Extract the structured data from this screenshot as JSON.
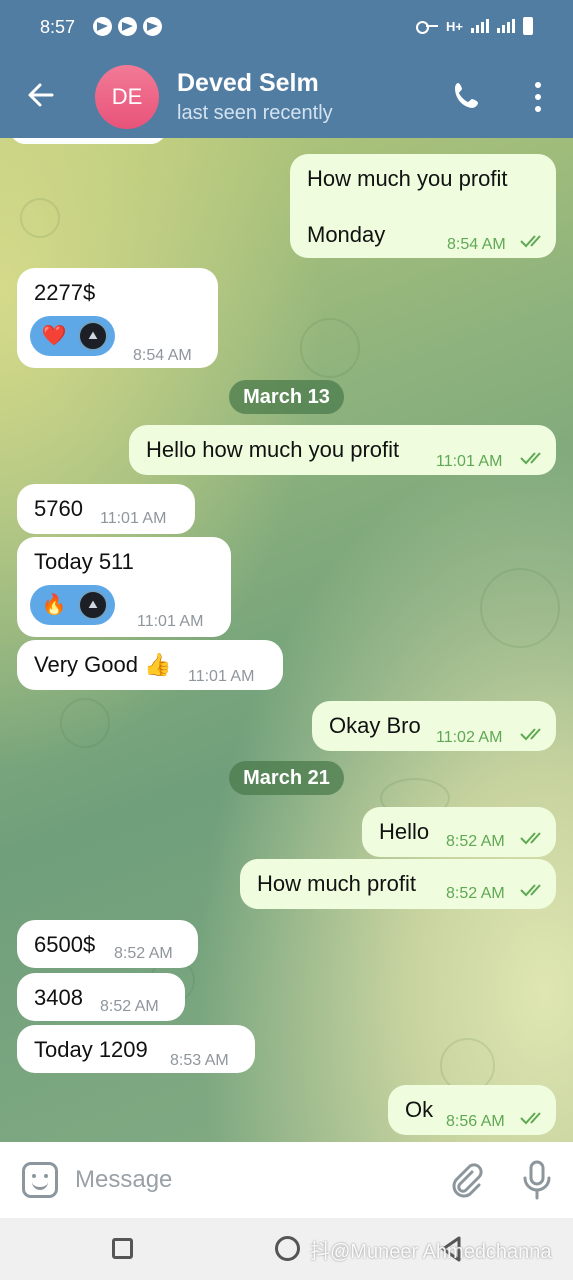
{
  "status_bar": {
    "time": "8:57",
    "network": "H+"
  },
  "header": {
    "avatar_initials": "DE",
    "name": "Deved Selm",
    "status": "last seen recently"
  },
  "dates": [
    "March 13",
    "March 21"
  ],
  "messages": [
    {
      "text": "How much you profit",
      "text2": "Monday",
      "time": "8:54 AM",
      "dir": "out"
    },
    {
      "text": "2277$",
      "time": "8:54 AM",
      "dir": "in",
      "reaction": "heart"
    },
    {
      "text": "Hello how much you profit",
      "time": "11:01 AM",
      "dir": "out"
    },
    {
      "text": "5760",
      "time": "11:01 AM",
      "dir": "in"
    },
    {
      "text": "Today 511",
      "time": "11:01 AM",
      "dir": "in",
      "reaction": "fire"
    },
    {
      "text": "Very Good 👍",
      "time": "11:01 AM",
      "dir": "in"
    },
    {
      "text": "Okay Bro",
      "time": "11:02 AM",
      "dir": "out"
    },
    {
      "text": "Hello",
      "time": "8:52 AM",
      "dir": "out"
    },
    {
      "text": "How much profit",
      "time": "8:52 AM",
      "dir": "out"
    },
    {
      "text": "6500$",
      "time": "8:52 AM",
      "dir": "in"
    },
    {
      "text": "3408",
      "time": "8:52 AM",
      "dir": "in"
    },
    {
      "text": "Today 1209",
      "time": "8:53 AM",
      "dir": "in"
    },
    {
      "text": "Ok",
      "time": "8:56 AM",
      "dir": "out"
    }
  ],
  "reactions": {
    "heart": "❤️",
    "fire": "🔥"
  },
  "input": {
    "placeholder": "Message"
  },
  "watermark": "抖@Muneer Ahmedchanna",
  "colors": {
    "header": "#527da3",
    "outgoing_bubble": "#effdde",
    "incoming_bubble": "#ffffff",
    "read_checks": "#5fa854"
  }
}
